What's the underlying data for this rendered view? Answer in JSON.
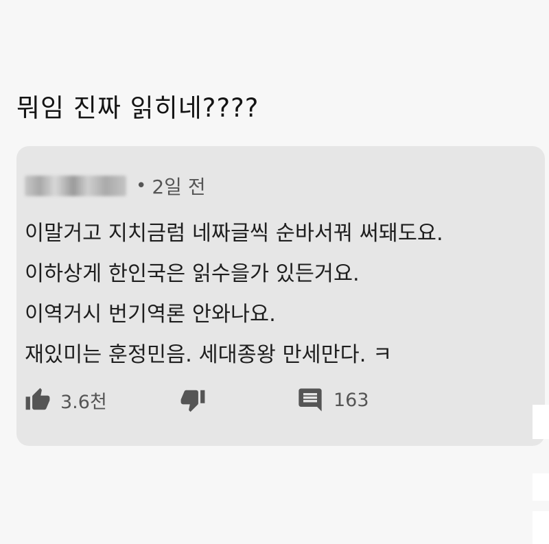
{
  "post": {
    "title": "뭐임 진짜 읽히네????"
  },
  "comment": {
    "time": "2일 전",
    "separator": "•",
    "lines": [
      "이말거고 지치금럼 네짜글씩 순바서꿔 써돼도요.",
      "이하상게 한인국은 읽수을가 있든거요.",
      "이역거시 번기역론 안와나요.",
      "재있미는 훈정민음. 세대종왕 만세만다. ㅋ"
    ],
    "actions": {
      "like_count": "3.6천",
      "reply_count": "163"
    }
  },
  "icons": {
    "like": "thumbs-up-icon",
    "dislike": "thumbs-down-icon",
    "reply": "reply-icon"
  },
  "colors": {
    "card_background": "#e6e6e6",
    "page_background": "#f7f7f7",
    "icon": "#555555"
  }
}
